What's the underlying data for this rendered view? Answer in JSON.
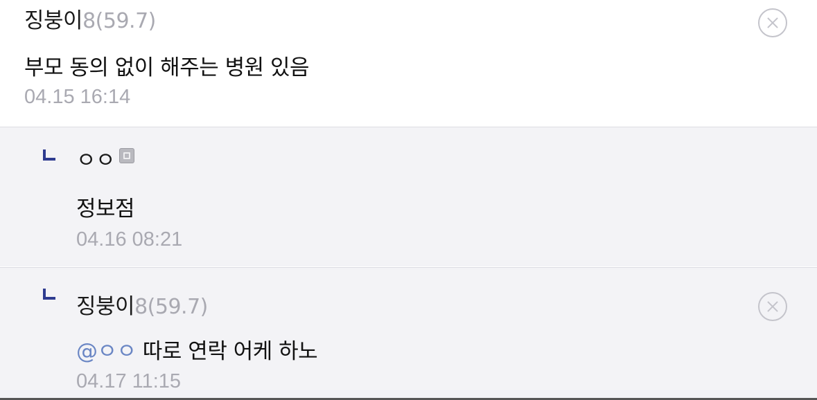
{
  "comments": [
    {
      "author": "징붕이",
      "score": "8(59.7)",
      "text": "부모 동의 없이 해주는 병원 있음",
      "time": "04.15 16:14",
      "is_reply": false,
      "deletable": true
    },
    {
      "author": "ㅇㅇ",
      "score": "",
      "text": "정보점",
      "time": "04.16 08:21",
      "is_reply": true,
      "deletable": false,
      "badge_icon": "badge-icon"
    },
    {
      "author": "징붕이",
      "score": "8(59.7)",
      "mention": "@ㅇㅇ",
      "text": "따로 연락 어케 하노",
      "time": "04.17 11:15",
      "is_reply": true,
      "deletable": true
    }
  ],
  "icons": {
    "delete": "close-circle-icon",
    "reply": "reply-arrow-icon"
  },
  "colors": {
    "reply_background": "#f3f3f6",
    "reply_mark": "#2e3b8f",
    "mention": "#6a86c4",
    "muted": "#a9a9b1"
  }
}
